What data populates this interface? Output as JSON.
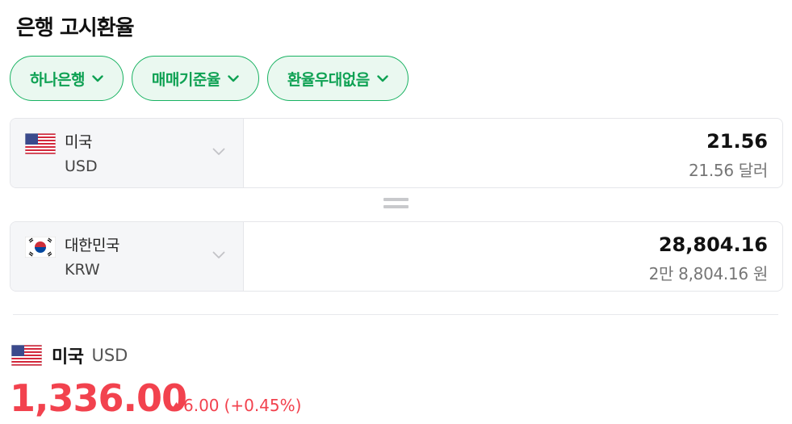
{
  "header": {
    "title": "은행 고시환율"
  },
  "filters": [
    {
      "label": "하나은행"
    },
    {
      "label": "매매기준율"
    },
    {
      "label": "환율우대없음"
    }
  ],
  "converter": {
    "from": {
      "country": "미국",
      "code": "USD",
      "flag": "us-flag-icon",
      "amount": "21.56",
      "amount_text": "21.56 달러"
    },
    "to": {
      "country": "대한민국",
      "code": "KRW",
      "flag": "kr-flag-icon",
      "amount": "28,804.16",
      "amount_text": "2만 8,804.16 원"
    }
  },
  "rate": {
    "country": "미국",
    "code": "USD",
    "value": "1,336.00",
    "change": "6.00",
    "change_pct": "(+0.45%)",
    "direction": "up"
  },
  "colors": {
    "accent_green": "#0ea153",
    "chip_bg": "#eaf8f0",
    "rise_red": "#f2424e"
  }
}
